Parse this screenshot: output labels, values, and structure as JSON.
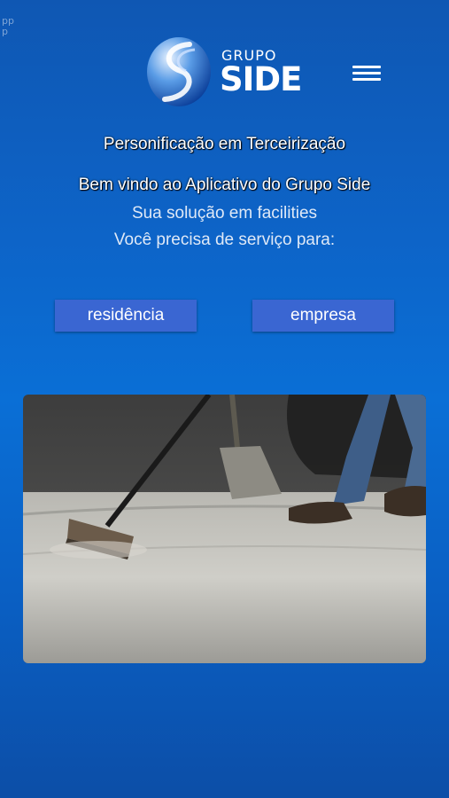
{
  "corner": {
    "text": "pp\np"
  },
  "header": {
    "logo_small": "GRUPO",
    "logo_big": "SIDE"
  },
  "texts": {
    "line1": "Personificação em Terceirização",
    "line2": "Bem vindo ao Aplicativo do Grupo Side",
    "line3": "Sua solução em facilities",
    "line4": "Você precisa de serviço para:"
  },
  "buttons": {
    "residencia": "residência",
    "empresa": "empresa"
  },
  "colors": {
    "background": "#0d64c8",
    "button": "#3a66d2"
  }
}
